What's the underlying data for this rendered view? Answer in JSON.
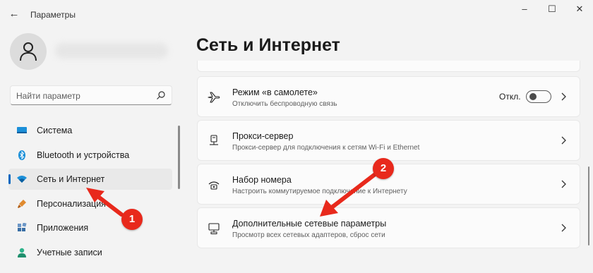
{
  "window": {
    "title": "Параметры",
    "back_glyph": "←",
    "minimize_glyph": "–",
    "maximize_glyph": "☐",
    "close_glyph": "✕"
  },
  "search": {
    "placeholder": "Найти параметр"
  },
  "sidebar": {
    "items": [
      {
        "label": "Система",
        "icon": "monitor-icon",
        "active": false
      },
      {
        "label": "Bluetooth и устройства",
        "icon": "bluetooth-icon",
        "active": false
      },
      {
        "label": "Сеть и Интернет",
        "icon": "wifi-icon",
        "active": true
      },
      {
        "label": "Персонализация",
        "icon": "brush-icon",
        "active": false
      },
      {
        "label": "Приложения",
        "icon": "apps-icon",
        "active": false
      },
      {
        "label": "Учетные записи",
        "icon": "user-icon",
        "active": false
      }
    ]
  },
  "main": {
    "title": "Сеть и Интернет",
    "cards": [
      {
        "title": "Режим «в самолете»",
        "subtitle": "Отключить беспроводную связь",
        "icon": "airplane-icon",
        "toggle_label": "Откл.",
        "toggle_on": false
      },
      {
        "title": "Прокси-сервер",
        "subtitle": "Прокси-сервер для подключения к сетям Wi-Fi и Ethernet",
        "icon": "proxy-icon"
      },
      {
        "title": "Набор номера",
        "subtitle": "Настроить коммутируемое подключение к Интернету",
        "icon": "dialup-icon"
      },
      {
        "title": "Дополнительные сетевые параметры",
        "subtitle": "Просмотр всех сетевых адаптеров, сброс сети",
        "icon": "network-adapter-icon"
      }
    ]
  },
  "annotations": {
    "badge1": "1",
    "badge2": "2",
    "color": "#e8291c"
  },
  "colors": {
    "accent": "#0067c0",
    "background": "#f3f3f3",
    "card": "#fbfbfb"
  }
}
